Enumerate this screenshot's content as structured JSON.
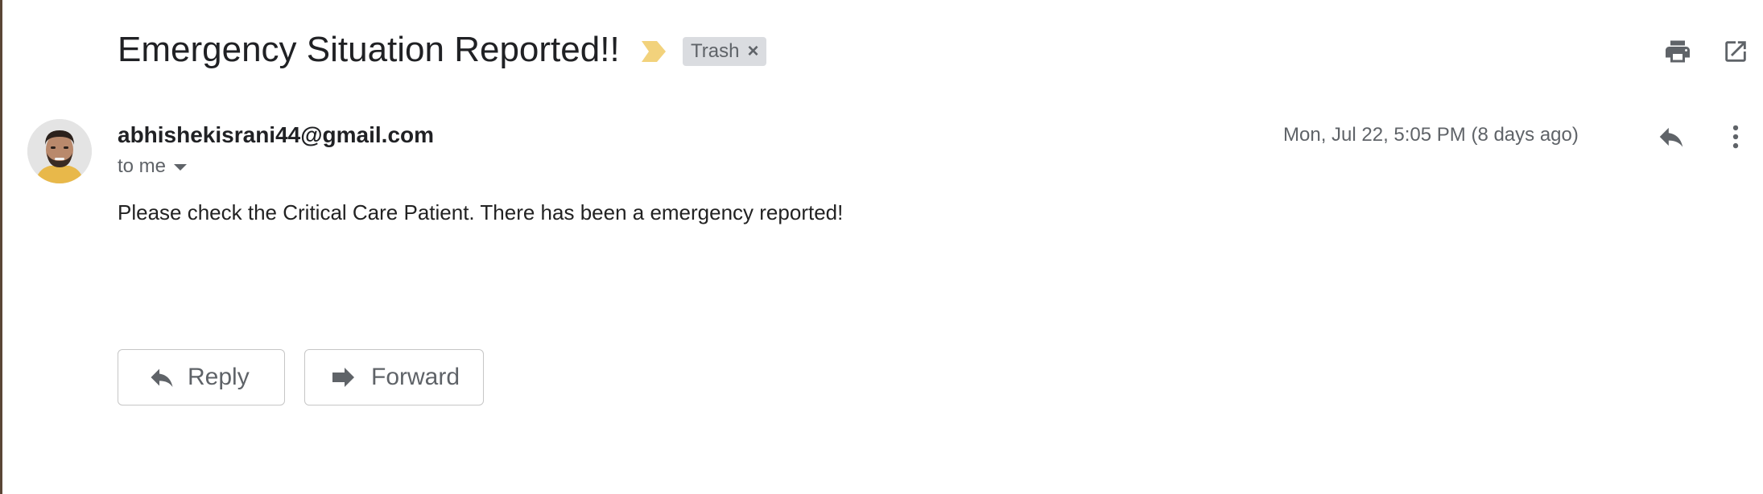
{
  "email": {
    "subject": "Emergency Situation Reported!!",
    "label": "Trash",
    "sender": "abhishekisrani44@gmail.com",
    "recipient": "to me",
    "date": "Mon, Jul 22, 5:05 PM (8 days ago)",
    "body": "Please check the Critical Care Patient. There has been a emergency reported!"
  },
  "actions": {
    "reply_label": "Reply",
    "forward_label": "Forward"
  },
  "icons": {
    "importance": "importance-marker-icon",
    "label_remove": "close-icon",
    "print": "print-icon",
    "open_new_window": "open-in-new-window-icon",
    "reply": "reply-icon",
    "more": "more-vert-icon",
    "forward": "forward-icon",
    "recipient_details": "caret-down-icon"
  },
  "colors": {
    "importance": "#f2d27c",
    "label_bg": "#dadce0",
    "icon": "#5f6368"
  }
}
